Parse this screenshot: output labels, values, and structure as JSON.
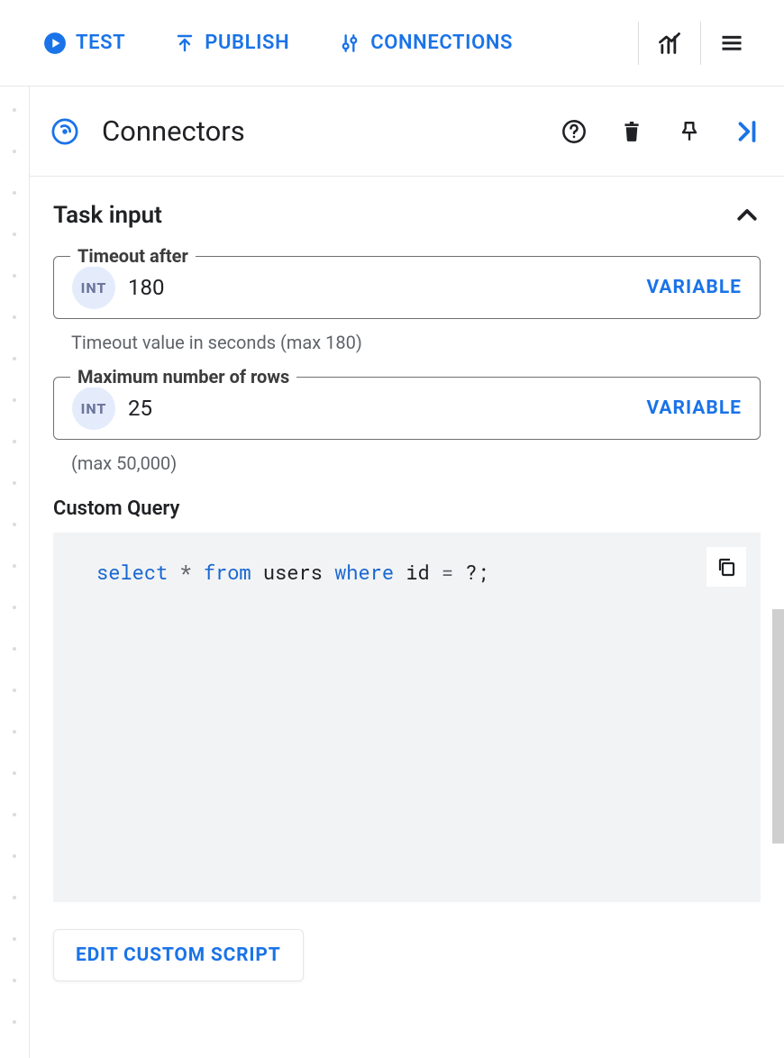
{
  "toolbar": {
    "test_label": "TEST",
    "publish_label": "PUBLISH",
    "connections_label": "CONNECTIONS"
  },
  "panel": {
    "title": "Connectors"
  },
  "section": {
    "title": "Task input"
  },
  "fields": {
    "int_chip": "INT",
    "timeout": {
      "label": "Timeout after",
      "value": "180",
      "helper": "Timeout value in seconds (max 180)",
      "variable": "VARIABLE"
    },
    "max_rows": {
      "label": "Maximum number of rows",
      "value": "25",
      "helper": "(max 50,000)",
      "variable": "VARIABLE"
    }
  },
  "query": {
    "label": "Custom Query",
    "tokens": {
      "select": "select",
      "star": "*",
      "from": "from",
      "users": "users",
      "where": "where",
      "idcol": "id",
      "eq": "=",
      "qmark": "?;"
    }
  },
  "buttons": {
    "edit_script": "EDIT CUSTOM SCRIPT"
  },
  "colors": {
    "accent": "#1a73e8"
  }
}
